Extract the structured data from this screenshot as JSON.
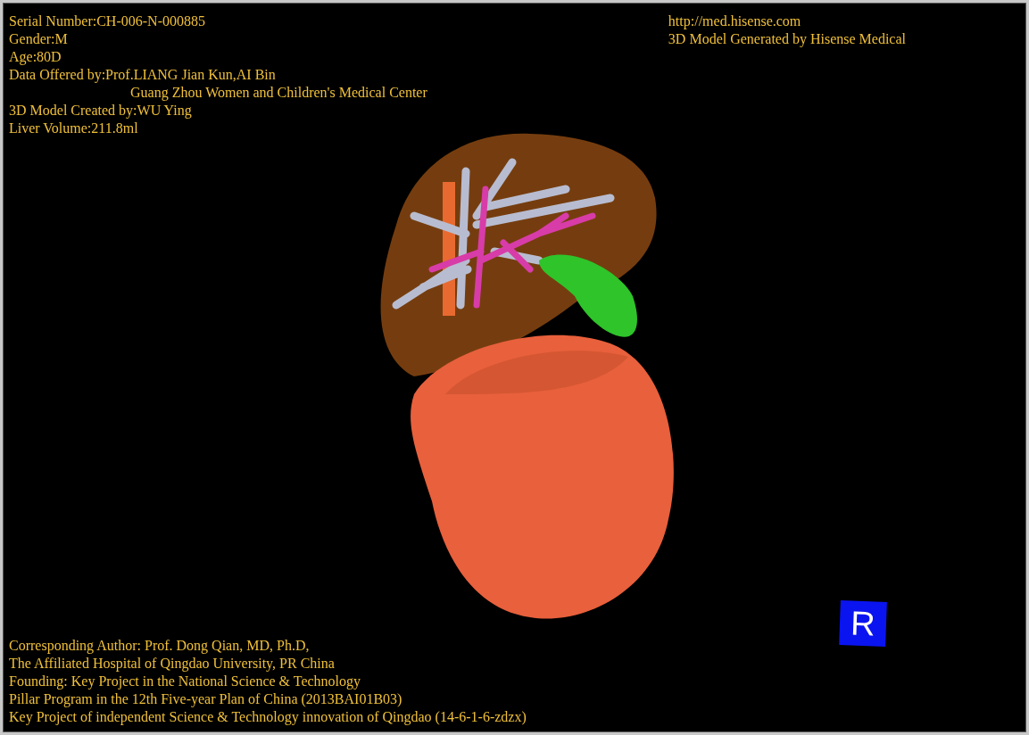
{
  "patient_info": [
    {
      "kind": "line",
      "text": "Serial Number:CH-006-N-000885"
    },
    {
      "kind": "line",
      "text": "Gender:M"
    },
    {
      "kind": "line",
      "text": "Age:80D"
    },
    {
      "kind": "line",
      "text": "Data Offered by:Prof.LIANG Jian Kun,AI Bin"
    },
    {
      "kind": "indented",
      "text": "Guang Zhou Women and Children's Medical Center"
    },
    {
      "kind": "line",
      "text": "3D Model Created by:WU Ying"
    },
    {
      "kind": "line",
      "text": "Liver Volume:211.8ml"
    }
  ],
  "vendor_info": [
    "http://med.hisense.com",
    "3D Model Generated by Hisense Medical"
  ],
  "credits": [
    "Corresponding Author: Prof. Dong Qian, MD, Ph.D,",
    "The Affiliated Hospital of Qingdao University, PR China",
    "Founding: Key Project in the National Science & Technology",
    "Pillar Program in the 12th Five-year Plan of China (2013BAI01B03)",
    "Key Project of independent Science & Technology innovation of Qingdao (14-6-1-6-zdzx)"
  ],
  "orientation_marker": {
    "label": "R"
  }
}
